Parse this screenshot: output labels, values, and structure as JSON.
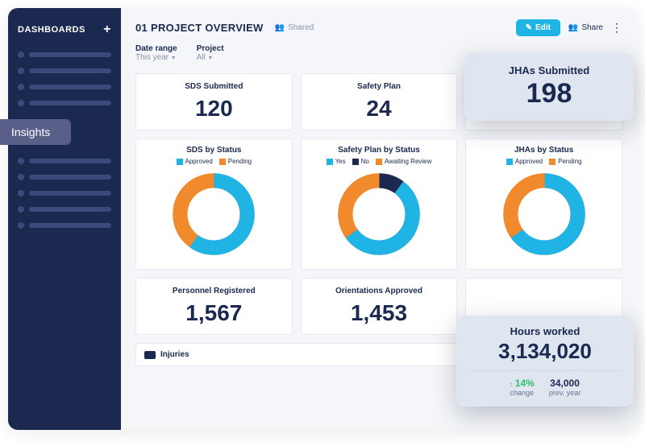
{
  "sidebar": {
    "title": "DASHBOARDS",
    "insights_label": "Insights"
  },
  "header": {
    "title": "01 PROJECT OVERVIEW",
    "shared_label": "Shared",
    "edit_label": "Edit",
    "share_label": "Share"
  },
  "filters": {
    "range_label": "Date range",
    "range_value": "This year",
    "project_label": "Project",
    "project_value": "All"
  },
  "stats": {
    "sds": {
      "title": "SDS Submitted",
      "value": "120"
    },
    "safety": {
      "title": "Safety Plan",
      "value": "24"
    },
    "jhas": {
      "title": "JHAs Submitted",
      "value": "198"
    },
    "personnel": {
      "title": "Personnel Registered",
      "value": "1,567"
    },
    "orientations": {
      "title": "Orientations Approved",
      "value": "1,453"
    }
  },
  "charts": {
    "sds": {
      "title": "SDS by Status",
      "legend": [
        "Approved",
        "Pending"
      ]
    },
    "safety": {
      "title": "Safety Plan by Status",
      "legend": [
        "Yes",
        "No",
        "Awaiting Review"
      ]
    },
    "jhas": {
      "title": "JHAs by Status",
      "legend": [
        "Approved",
        "Pending"
      ]
    }
  },
  "injuries_label": "Injuries",
  "popups": {
    "jhas": {
      "title": "JHAs Submitted",
      "value": "198"
    },
    "hours": {
      "title": "Hours worked",
      "value": "3,134,020",
      "change_pct": "14%",
      "change_label": "change",
      "prev_value": "34,000",
      "prev_label": "prev. year"
    }
  },
  "colors": {
    "blue": "#20b4e4",
    "orange": "#f08a2c",
    "navy": "#1b2850",
    "green": "#2ec06a"
  },
  "chart_data": [
    {
      "type": "pie",
      "title": "SDS by Status",
      "series": [
        {
          "name": "Approved",
          "value": 60,
          "color": "#20b4e4"
        },
        {
          "name": "Pending",
          "value": 40,
          "color": "#f08a2c"
        }
      ]
    },
    {
      "type": "pie",
      "title": "Safety Plan by Status",
      "series": [
        {
          "name": "Yes",
          "value": 55,
          "color": "#20b4e4"
        },
        {
          "name": "No",
          "value": 10,
          "color": "#1b2850"
        },
        {
          "name": "Awaiting Review",
          "value": 35,
          "color": "#f08a2c"
        }
      ]
    },
    {
      "type": "pie",
      "title": "JHAs by Status",
      "series": [
        {
          "name": "Approved",
          "value": 65,
          "color": "#20b4e4"
        },
        {
          "name": "Pending",
          "value": 35,
          "color": "#f08a2c"
        }
      ]
    }
  ]
}
